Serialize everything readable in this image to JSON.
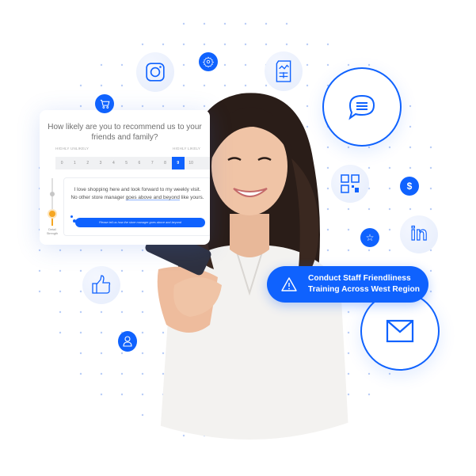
{
  "survey": {
    "question": "How likely are you to recommend us to your friends and family?",
    "low_label": "HIGHLY UNLIKELY",
    "high_label": "HIGHLY LIKELY",
    "scale": [
      "0",
      "1",
      "2",
      "3",
      "4",
      "5",
      "6",
      "7",
      "8",
      "9",
      "10"
    ],
    "selected": "9",
    "review_text_before": "I love shopping here and look forward to my weekly visit. No other store manager ",
    "review_highlight": "goes above and beyond",
    "review_text_after": " like yours.",
    "prompt_button": "Please tell us how the store manager goes above and beyond",
    "slider_label": "Detail Strength",
    "slider_value": 0.3
  },
  "alert": {
    "icon": "warning-icon",
    "line1": "Conduct Staff Friendliness",
    "line2": "Training Across West Region"
  },
  "icons": {
    "instagram": "instagram-icon",
    "settings": "gear-icon",
    "report": "report-document-icon",
    "chat": "chat-bubble-icon",
    "cart": "shopping-cart-icon",
    "qr": "qr-code-icon",
    "dollar": "dollar-icon",
    "star": "star-icon",
    "linkedin": "linkedin-icon",
    "thumbs_up": "thumbs-up-icon",
    "user": "user-icon",
    "mail": "mail-icon"
  },
  "colors": {
    "brand_blue": "#0f62fe",
    "soft_blue": "#e6edfc",
    "accent_orange": "#f5a623"
  }
}
